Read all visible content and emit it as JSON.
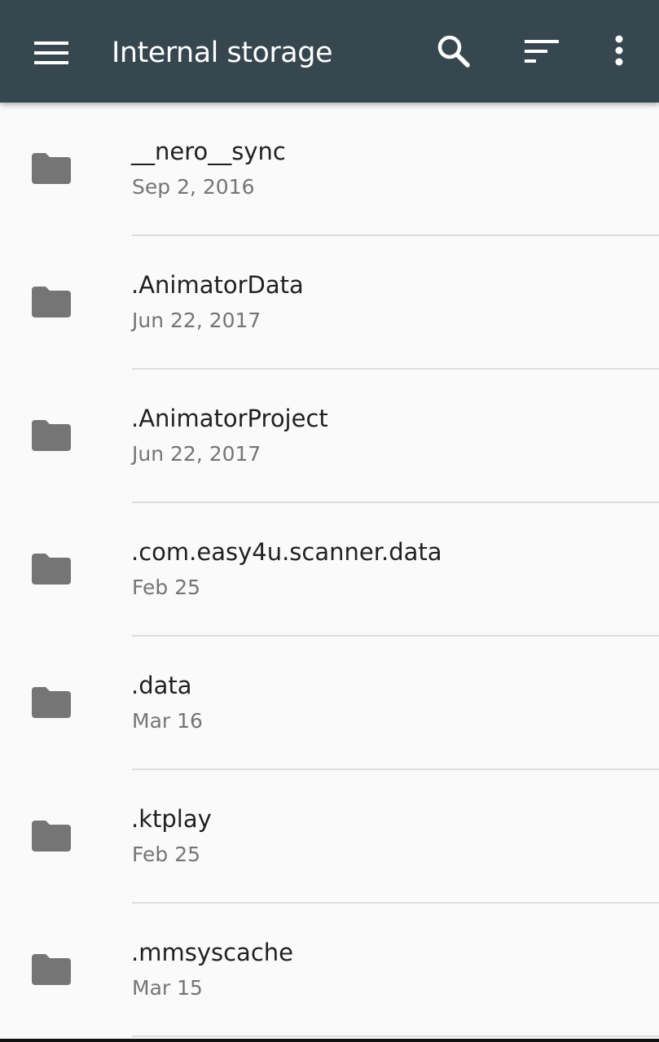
{
  "app_bar": {
    "title": "Internal storage",
    "icons": [
      "menu-icon",
      "search-icon",
      "sort-icon",
      "more-vert-icon"
    ]
  },
  "colors": {
    "app_bar_bg": "#37474f",
    "list_bg": "#fafafa",
    "folder_icon": "#757575",
    "name_text": "#212121",
    "date_text": "#757575",
    "divider": "#dedede"
  },
  "files": [
    {
      "name": "__nero__sync",
      "date": "Sep 2, 2016"
    },
    {
      "name": ".AnimatorData",
      "date": "Jun 22, 2017"
    },
    {
      "name": ".AnimatorProject",
      "date": "Jun 22, 2017"
    },
    {
      "name": ".com.easy4u.scanner.data",
      "date": "Feb 25"
    },
    {
      "name": ".data",
      "date": "Mar 16"
    },
    {
      "name": ".ktplay",
      "date": "Feb 25"
    },
    {
      "name": ".mmsyscache",
      "date": "Mar 15"
    }
  ]
}
